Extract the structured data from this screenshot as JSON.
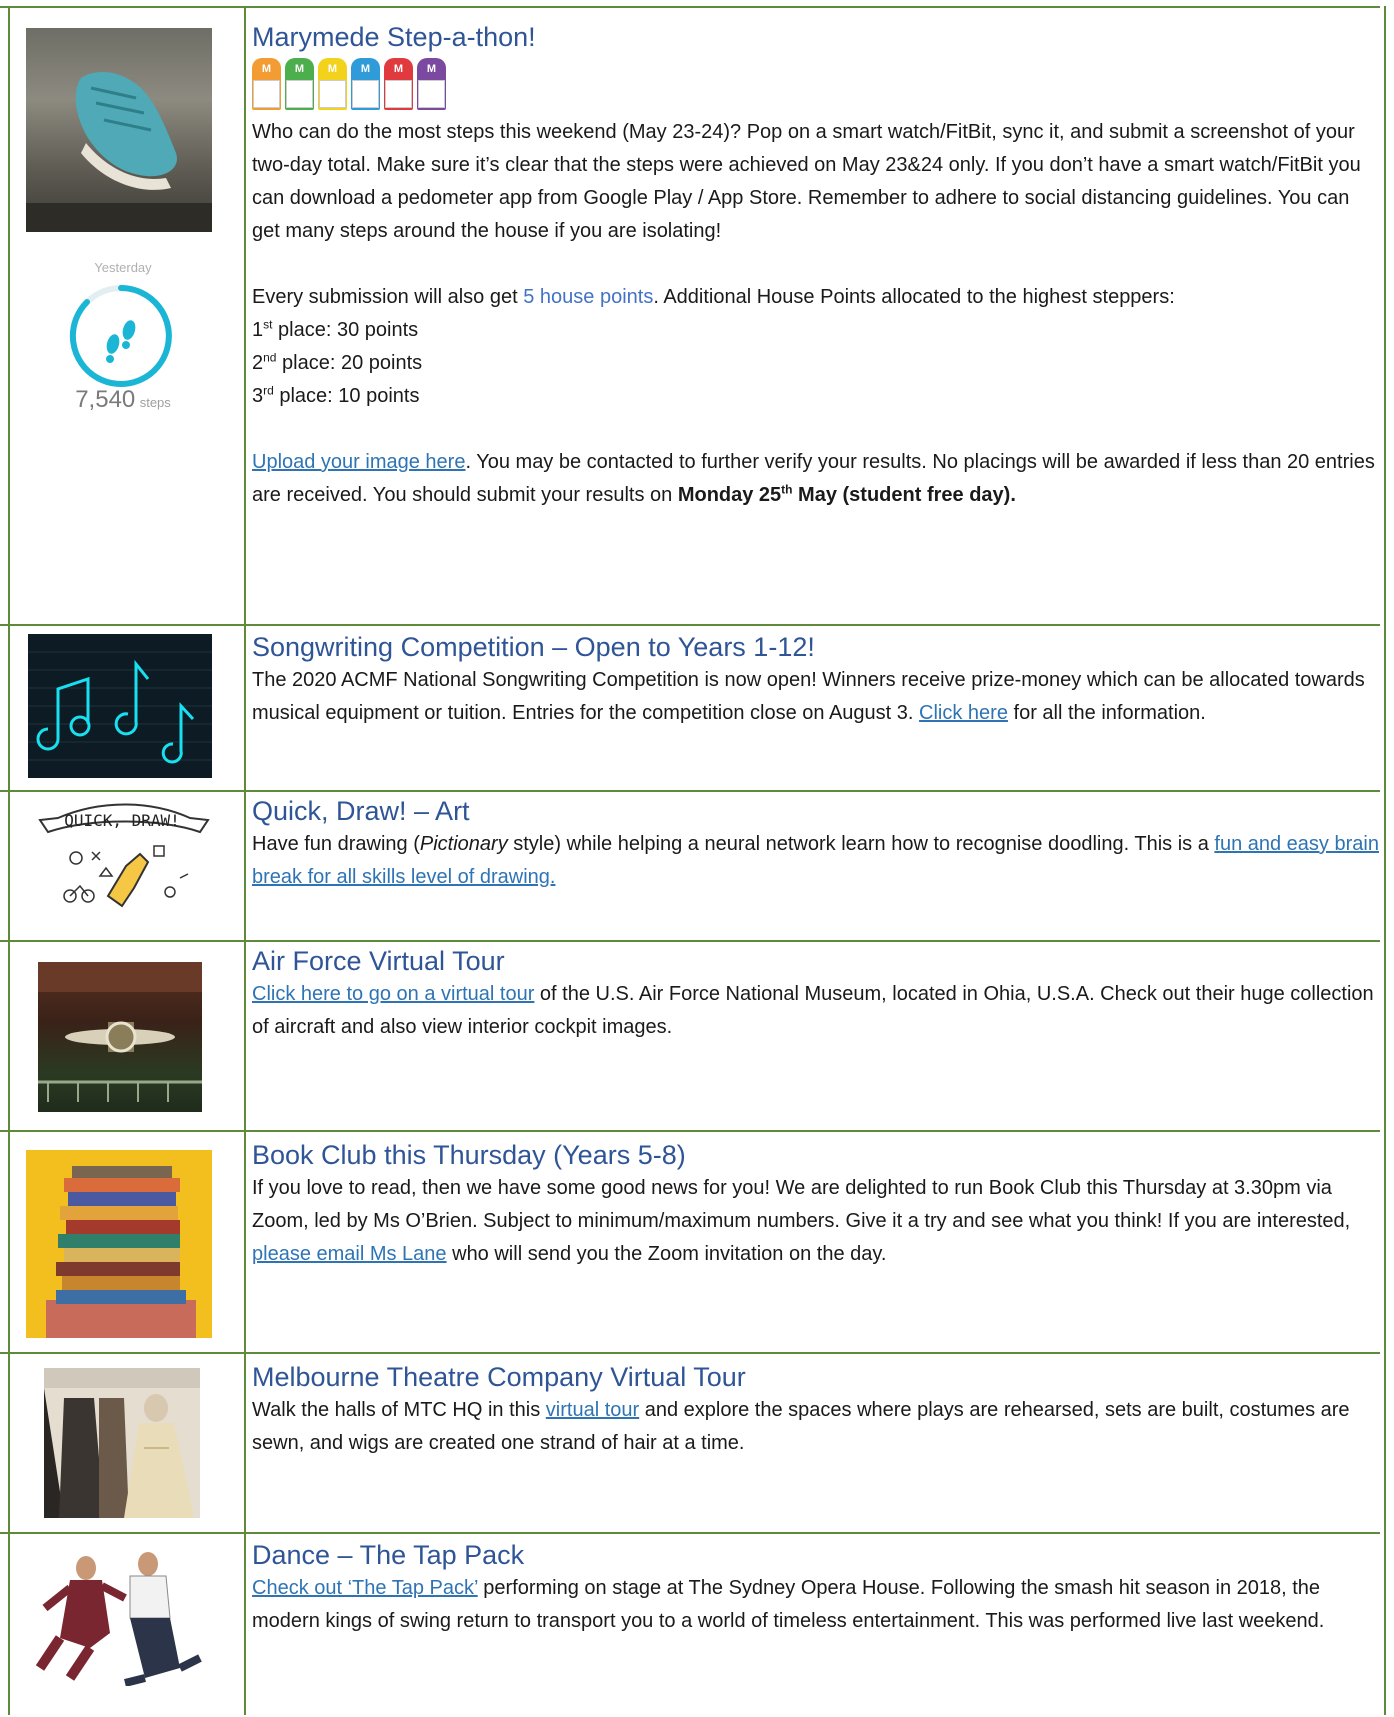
{
  "colors": {
    "border": "#5e8a3a",
    "title": "#2f5597",
    "link": "#2e74b5"
  },
  "step": {
    "title": "Marymede Step-a-thon!",
    "house_badges": [
      "M",
      "M",
      "M",
      "M",
      "M",
      "M"
    ],
    "widget_label": "Yesterday",
    "widget_steps": "7,540",
    "widget_unit": "steps",
    "p1": "Who can do the most steps this weekend (May 23-24)? Pop on a smart watch/FitBit, sync it, and submit a screenshot of your two-day total. Make sure it’s clear that the steps were achieved on May 23&24 only. If you don’t have a smart watch/FitBit you can download a pedometer app from Google Play / App Store. Remember to adhere to social distancing guidelines. You can get many steps around the house if you are isolating!",
    "p2_a": "Every submission will also get ",
    "p2_link": "5 house points",
    "p2_b": ". Additional House Points allocated to the highest steppers:",
    "place1_n": "1",
    "place1_sup": "st",
    "place1_text": " place: 30 points",
    "place2_n": "2",
    "place2_sup": "nd",
    "place2_text": " place: 20 points",
    "place3_n": "3",
    "place3_sup": "rd",
    "place3_text": " place: 10 points",
    "p3_link": "Upload your image here",
    "p3_a": ". You may be contacted to further verify your results. No placings will be awarded if less than 20 entries are received. You should submit your results on ",
    "p3_bold1": "Monday 25",
    "p3_sup": "th",
    "p3_bold2": " May (student free day)."
  },
  "song": {
    "title": "Songwriting Competition – Open to Years 1-12!",
    "p_a": "The 2020 ACMF National Songwriting Competition is now open! Winners receive prize-money which can be allocated towards musical equipment or tuition. Entries for the competition close on August 3. ",
    "p_link": "Click here",
    "p_b": " for all the information."
  },
  "quickdraw": {
    "title": "Quick, Draw! – Art",
    "logo_text": "QUICK, DRAW!",
    "p_a": "Have fun drawing (",
    "p_em": "Pictionary",
    "p_b": " style) while helping a neural network learn how to recognise doodling. This is a ",
    "p_link": "fun and easy brain break for all skills level of drawing."
  },
  "airforce": {
    "title": "Air Force Virtual Tour",
    "p_link": "Click here to go on a virtual tour",
    "p_a": " of the U.S. Air Force National Museum, located in Ohia, U.S.A. Check out their huge collection of aircraft and also view interior cockpit images."
  },
  "book": {
    "title": "Book Club this Thursday (Years 5-8)",
    "p_a": "If you love to read, then we have some good news for you! We are delighted to run Book Club this Thursday at 3.30pm via Zoom, led by Ms O’Brien. Subject to minimum/maximum numbers. Give it a try and see what you think! If you are interested, ",
    "p_link": "please email Ms Lane",
    "p_b": " who will send you the Zoom invitation on the day."
  },
  "mtc": {
    "title": "Melbourne Theatre Company Virtual Tour",
    "p_a": "Walk the halls of MTC HQ in this ",
    "p_link": "virtual tour",
    "p_b": " and explore the spaces where plays are rehearsed, sets are built, costumes are sewn, and wigs are created one strand of hair at a time."
  },
  "dance": {
    "title": "Dance – The Tap Pack",
    "p_link": "Check out ‘The Tap Pack’",
    "p_a": " performing on stage at The Sydney Opera House. Following the smash hit season in 2018, the modern kings of swing return to transport you to a world of timeless entertainment. This was performed live last weekend."
  }
}
